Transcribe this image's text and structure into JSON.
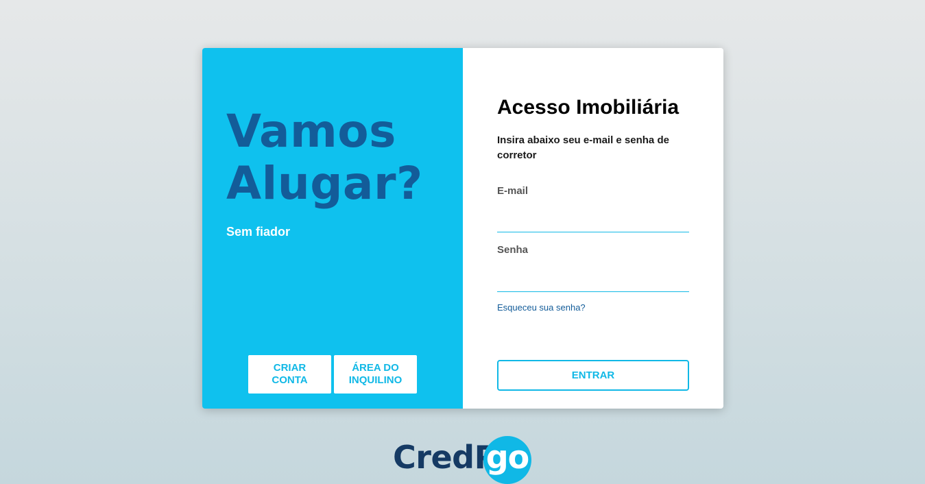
{
  "hero": {
    "headline_line1": "Vamos",
    "headline_line2": "Alugar?",
    "tagline": "Sem fiador",
    "buttons": [
      {
        "label": "CRIAR CONTA"
      },
      {
        "label": "ÁREA DO INQUILINO"
      }
    ]
  },
  "login": {
    "title": "Acesso Imobiliária",
    "subtitle": "Insira abaixo seu e-mail e senha de corretor",
    "email_label": "E-mail",
    "email_value": "",
    "password_label": "Senha",
    "password_value": "",
    "forgot_link": "Esqueceu sua senha?",
    "submit_label": "ENTRAR"
  },
  "brand": {
    "logo_part1": "CredPa",
    "logo_part2": "go",
    "primary_color": "#0fc1ee",
    "dark_color": "#135c99",
    "logo_dark_color": "#153a64"
  }
}
